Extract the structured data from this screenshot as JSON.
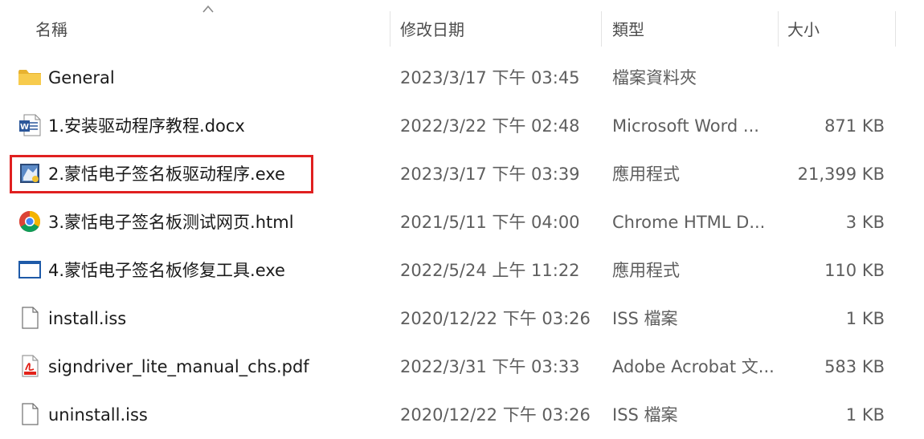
{
  "header": {
    "name_label": "名稱",
    "date_label": "修改日期",
    "type_label": "類型",
    "size_label": "大小"
  },
  "files": [
    {
      "name": "General",
      "date": "2023/3/17 下午 03:45",
      "type": "檔案資料夾",
      "size": "",
      "icon": "folder-icon"
    },
    {
      "name": "1.安装驱动程序教程.docx",
      "date": "2022/3/22 下午 02:48",
      "type": "Microsoft Word ...",
      "size": "871 KB",
      "icon": "word-document-icon"
    },
    {
      "name": "2.蒙恬电子签名板驱动程序.exe",
      "date": "2023/3/17 下午 03:39",
      "type": "應用程式",
      "size": "21,399 KB",
      "icon": "installer-icon"
    },
    {
      "name": "3.蒙恬电子签名板测试网页.html",
      "date": "2021/5/11 下午 04:00",
      "type": "Chrome HTML D...",
      "size": "3 KB",
      "icon": "chrome-icon"
    },
    {
      "name": "4.蒙恬电子签名板修复工具.exe",
      "date": "2022/5/24 上午 11:22",
      "type": "應用程式",
      "size": "110 KB",
      "icon": "application-window-icon"
    },
    {
      "name": "install.iss",
      "date": "2020/12/22 下午 03:26",
      "type": "ISS 檔案",
      "size": "1 KB",
      "icon": "blank-file-icon"
    },
    {
      "name": "signdriver_lite_manual_chs.pdf",
      "date": "2022/3/31 下午 03:33",
      "type": "Adobe Acrobat 文...",
      "size": "583 KB",
      "icon": "pdf-icon"
    },
    {
      "name": "uninstall.iss",
      "date": "2020/12/22 下午 03:26",
      "type": "ISS 檔案",
      "size": "1 KB",
      "icon": "blank-file-icon"
    }
  ],
  "colors": {
    "highlight": "#e02020",
    "folder": "#f5c342",
    "word": "#2b579a",
    "pdf": "#e2231a"
  }
}
